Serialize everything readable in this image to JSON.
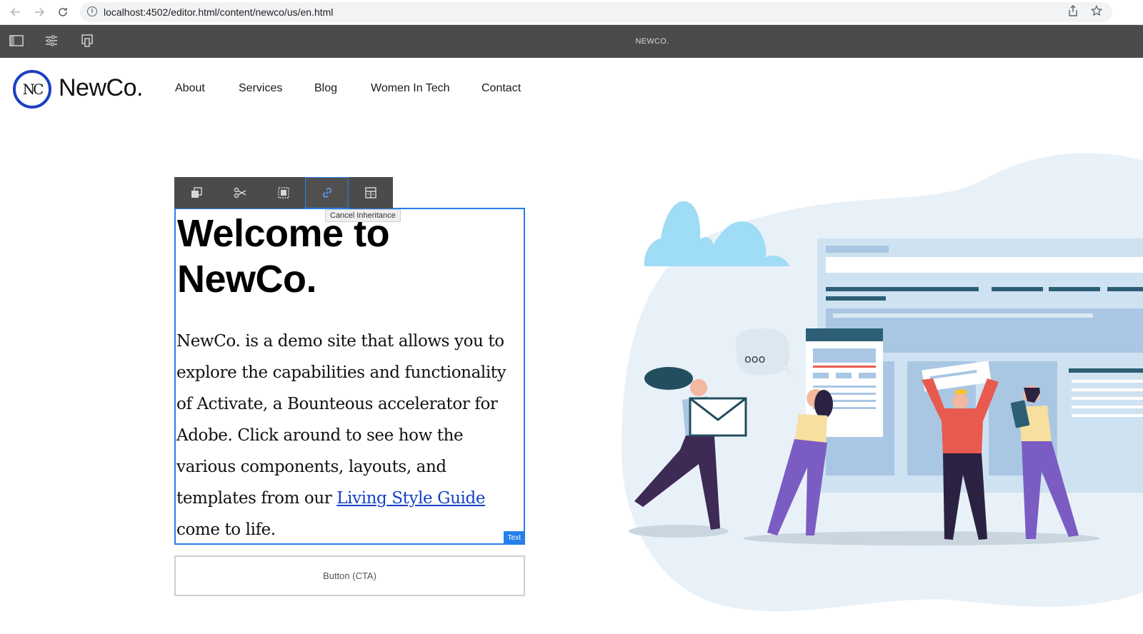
{
  "browser": {
    "url": "localhost:4502/editor.html/content/newco/us/en.html"
  },
  "editor": {
    "title": "NEWCO."
  },
  "site": {
    "logo_initials": "NC",
    "logo_text": "NewCo.",
    "nav": [
      "About",
      "Services",
      "Blog",
      "Women In Tech",
      "Contact"
    ]
  },
  "toolbar": {
    "tooltip": "Cancel Inheritance"
  },
  "content": {
    "headline_line1": "Welcome to",
    "headline_line2": "NewCo.",
    "body_before_link": "NewCo. is a demo site that allows you to explore the capabilities and functionality of Activate, a Bounteous accelerator for Adobe. Click around to see how the various components, layouts, and templates from our ",
    "link_text": "Living Style Guide",
    "body_after_link": " come to life.",
    "component_tag": "Text",
    "cta_label": "Button (CTA)"
  },
  "illustration": {
    "speech_bubble": "ooo"
  },
  "colors": {
    "accent": "#2680eb",
    "logo_blue": "#1c3fc2",
    "editor_bar": "#4b4b4b",
    "link": "#1440c7"
  }
}
